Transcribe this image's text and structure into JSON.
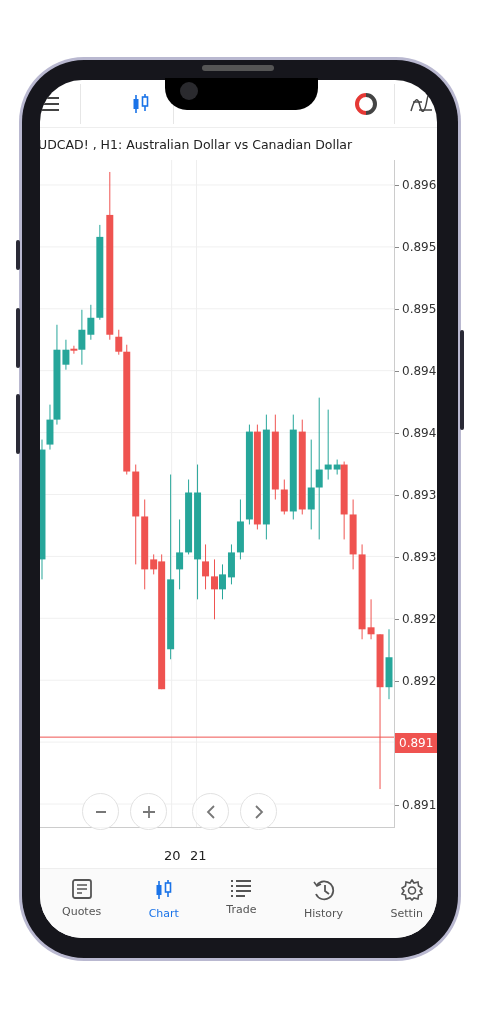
{
  "toolbar": [
    {
      "kind": "menu",
      "selected": false
    },
    {
      "kind": "chart",
      "selected": true
    },
    {
      "kind": "account",
      "selected": false
    },
    {
      "kind": "indicators",
      "selected": false
    }
  ],
  "chart_title": "UDCAD! , H1: Australian Dollar vs Canadian Dollar",
  "price_labels": [
    "0.896",
    "0.895",
    "0.895",
    "0.894",
    "0.894",
    "0.893",
    "0.893",
    "0.892",
    "0.892",
    "0.891"
  ],
  "current_price": "0.891",
  "chart_controls": [
    {
      "kind": "zoom-out"
    },
    {
      "kind": "zoom-in"
    },
    {
      "kind": "previous"
    },
    {
      "kind": "next"
    }
  ],
  "date_labels": [
    "20",
    "21"
  ],
  "nav": [
    {
      "kind": "quotes",
      "label": "Quotes",
      "selected": false
    },
    {
      "kind": "chart",
      "label": "Chart",
      "selected": true
    },
    {
      "kind": "trade",
      "label": "Trade",
      "selected": false
    },
    {
      "kind": "history",
      "label": "History",
      "selected": false
    },
    {
      "kind": "settings",
      "label": "Settin",
      "selected": false
    }
  ]
}
